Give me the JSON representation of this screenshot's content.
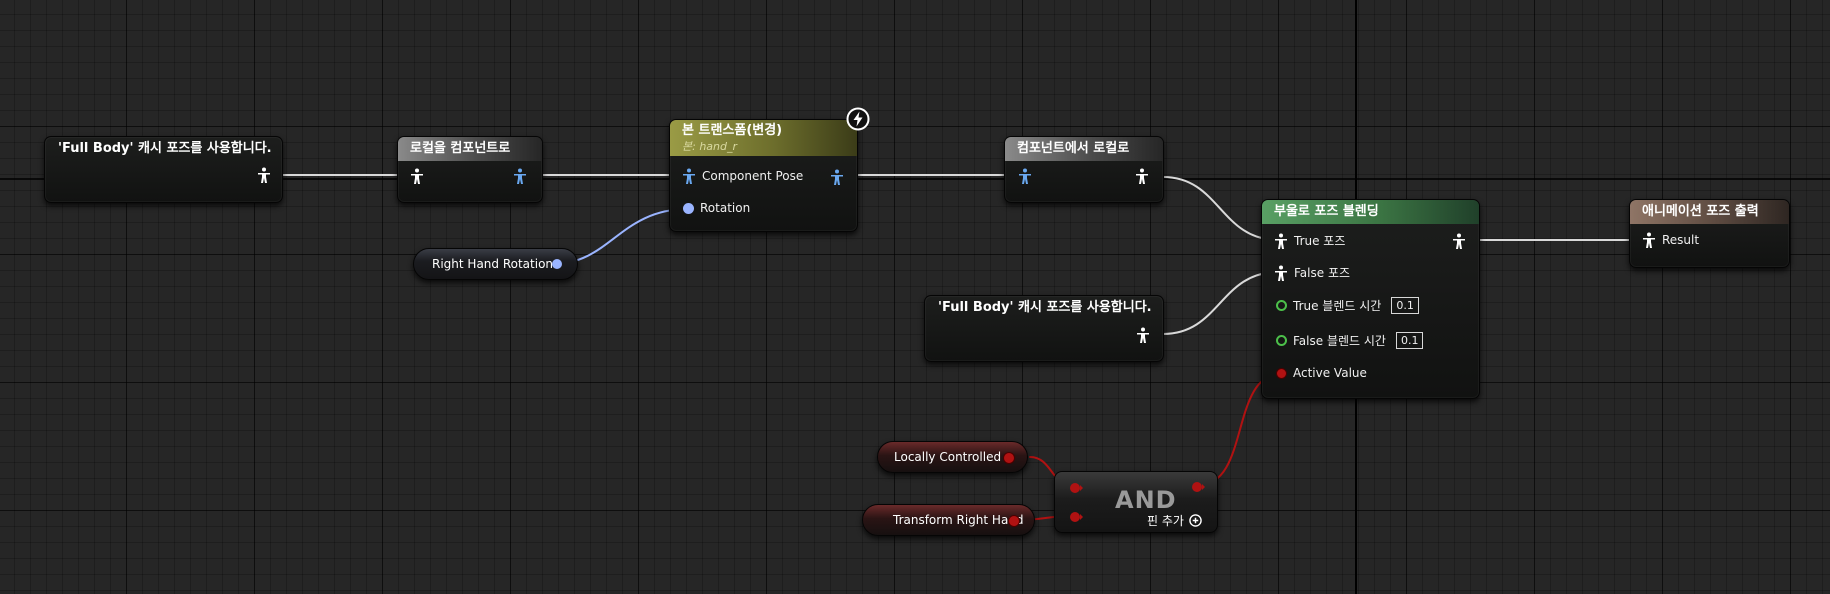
{
  "graph": {
    "cache_pose_1": {
      "label": "'Full Body' 캐시 포즈를 사용합니다."
    },
    "local_to_component": {
      "title": "로컬을 컴포넌트로"
    },
    "bone_transform": {
      "title": "본 트랜스폼(변경)",
      "subtitle": "본: hand_r",
      "pin_component_pose": "Component Pose",
      "pin_rotation": "Rotation"
    },
    "right_hand_rotation": {
      "label": "Right Hand Rotation"
    },
    "component_to_local": {
      "title": "컴포넌트에서 로컬로"
    },
    "cache_pose_2": {
      "label": "'Full Body' 캐시 포즈를 사용합니다."
    },
    "blend_by_bool": {
      "title": "부울로 포즈 블렌딩",
      "pin_true_pose": "True 포즈",
      "pin_false_pose": "False 포즈",
      "pin_true_blend": "True 블렌드 시간",
      "true_blend_value": "0.1",
      "pin_false_blend": "False 블렌드 시간",
      "false_blend_value": "0.1",
      "pin_active_value": "Active Value"
    },
    "output_pose": {
      "title": "애니메이션 포즈 출력",
      "pin_result": "Result"
    },
    "locally_controlled": {
      "label": "Locally Controlled"
    },
    "transform_right_hand": {
      "label": "Transform Right Hand"
    },
    "and_node": {
      "label": "AND",
      "add_pin": "핀 추가"
    }
  },
  "colors": {
    "pose_pin": "#ffffff",
    "component_pose_pin": "#6aa8f0",
    "rotator_pin": "#9ab4ff",
    "bool_pin": "#b01212",
    "float_pin": "#4cc04a",
    "pose_wire": "#d9d9d9"
  },
  "icons": [
    "pose-pin-icon",
    "component-pose-pin-icon",
    "rotator-pin-icon",
    "bool-pin-icon",
    "float-pin-icon",
    "lightning-badge-icon",
    "add-pin-icon"
  ]
}
